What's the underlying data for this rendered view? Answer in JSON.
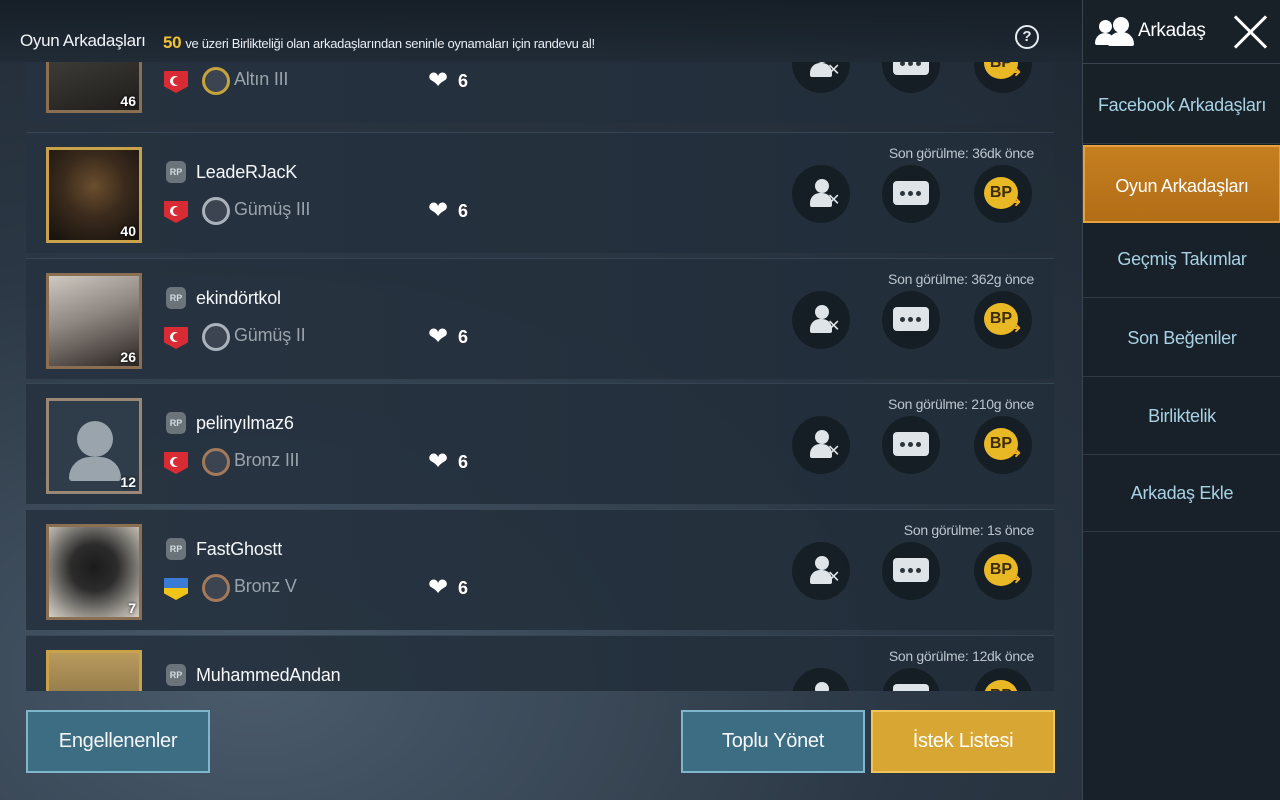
{
  "header": {
    "title": "Oyun Arkadaşları",
    "notice_number": "50",
    "notice_text": "ve üzeri Birlikteliği olan arkadaşlarından seninle oynamaları için randevu al!",
    "help_symbol": "?"
  },
  "icons": {
    "heart": "❤",
    "remove_x": "✕",
    "gift_coin": "BP",
    "gift_arrow": "➜"
  },
  "friends": [
    {
      "name": "",
      "level": "46",
      "tier": "Altın III",
      "likes": "6",
      "last_seen": ""
    },
    {
      "name": "LeadeRJacK",
      "level": "40",
      "tier": "Gümüş III",
      "likes": "6",
      "last_seen": "Son görülme: 36dk önce"
    },
    {
      "name": "ekindörtkol",
      "level": "26",
      "tier": "Gümüş II",
      "likes": "6",
      "last_seen": "Son görülme: 362g önce"
    },
    {
      "name": "pelinyılmaz6",
      "level": "12",
      "tier": "Bronz III",
      "likes": "6",
      "last_seen": "Son görülme: 210g önce"
    },
    {
      "name": "FastGhostt",
      "level": "7",
      "tier": "Bronz V",
      "likes": "6",
      "last_seen": "Son görülme: 1s önce"
    },
    {
      "name": "MuhammedAndan",
      "level": "",
      "tier": "",
      "likes": "",
      "last_seen": "Son görülme: 12dk önce"
    }
  ],
  "rp_label": "RP",
  "buttons": {
    "blocked": "Engellenenler",
    "bulk_manage": "Toplu Yönet",
    "request_list": "İstek Listesi"
  },
  "sidebar": {
    "title": "Arkadaş",
    "items": [
      {
        "label": "Facebook Arkadaşları"
      },
      {
        "label": "Oyun Arkadaşları"
      },
      {
        "label": "Geçmiş Takımlar"
      },
      {
        "label": "Son Beğeniler"
      },
      {
        "label": "Birliktelik"
      },
      {
        "label": "Arkadaş Ekle"
      }
    ]
  },
  "colors": {
    "accent_gold": "#d8a632",
    "button_blue": "#3d6d83",
    "active_tab": "#c57f20"
  }
}
